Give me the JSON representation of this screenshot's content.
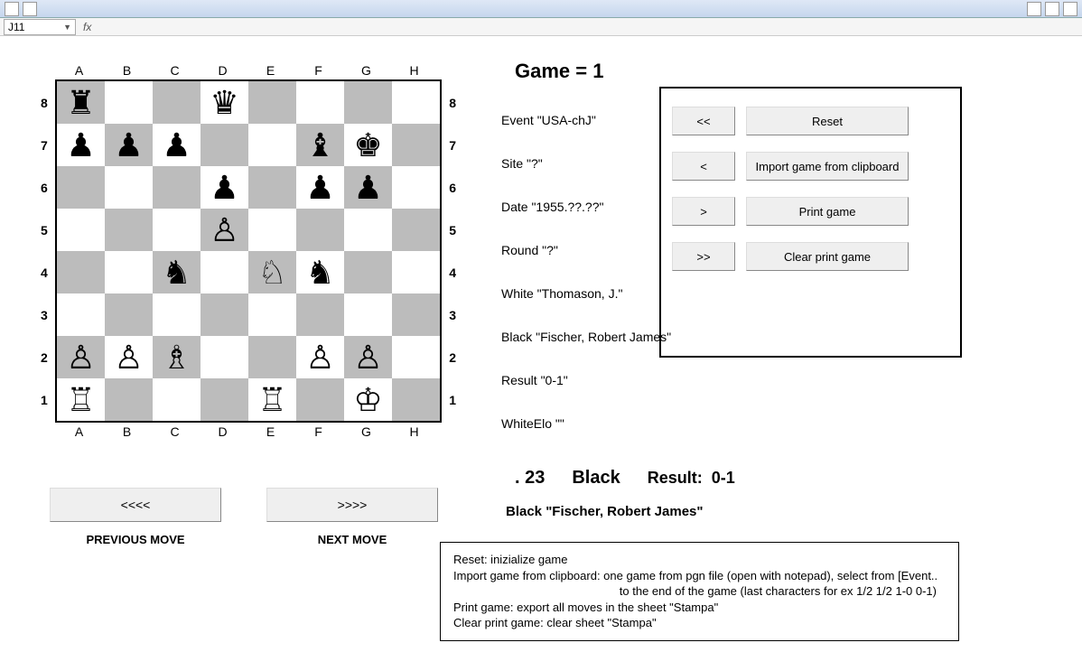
{
  "toolbar": {
    "cell_ref": "J11"
  },
  "game": {
    "title": "Game = 1",
    "move_num": ". 23",
    "turn": "Black",
    "result_label": "Result:",
    "result": "0-1",
    "player_line": "Black \"Fischer, Robert James\""
  },
  "info": {
    "event": "Event \"USA-chJ\"",
    "site": "Site \"?\"",
    "date": "Date \"1955.??.??\"",
    "round": "Round \"?\"",
    "white": "White \"Thomason, J.\"",
    "black": "Black \"Fischer, Robert James\"",
    "res": "Result \"0-1\"",
    "white_elo": "WhiteElo \"\""
  },
  "controls": {
    "first": "<<",
    "prev": "<",
    "next": ">",
    "last": ">>",
    "reset": "Reset",
    "import": "Import game from clipboard",
    "print": "Print game",
    "clear": "Clear print game"
  },
  "nav": {
    "prev_sym": "<<<<",
    "next_sym": ">>>>",
    "prev_lbl": "PREVIOUS MOVE",
    "next_lbl": "NEXT MOVE"
  },
  "help": {
    "l1": "Reset: inizialize game",
    "l2": "Import game from clipboard: one game from pgn file (open with notepad), select from [Event..",
    "l3": "to the end of the game (last characters for ex 1/2 1/2 1-0 0-1)",
    "l4": "Print game: export all moves in the sheet \"Stampa\"",
    "l5": "Clear print game: clear sheet \"Stampa\""
  },
  "board": {
    "files": [
      "A",
      "B",
      "C",
      "D",
      "E",
      "F",
      "G",
      "H"
    ],
    "ranks": [
      "8",
      "7",
      "6",
      "5",
      "4",
      "3",
      "2",
      "1"
    ],
    "pieces": {
      "a8": "♜",
      "d8": "♛",
      "a7": "♟",
      "b7": "♟",
      "c7": "♟",
      "f7": "♝",
      "g7": "♚",
      "d6": "♟",
      "f6": "♟",
      "g6": "♟",
      "d5": "♙",
      "c4": "♞",
      "e4": "♘",
      "f4": "♞",
      "a2": "♙",
      "b2": "♙",
      "c2": "♗",
      "f2": "♙",
      "g2": "♙",
      "a1": "♖",
      "e1": "♖",
      "g1": "♔"
    }
  }
}
